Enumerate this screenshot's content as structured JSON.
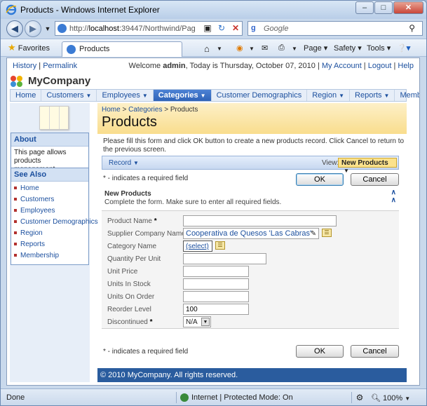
{
  "window": {
    "title": "Products - Windows Internet Explorer",
    "minimize": "–",
    "maximize": "□",
    "close": "✕"
  },
  "addressbar": {
    "url_prefix": "http://",
    "url_host": "localhost",
    "url_rest": ":39447/Northwind/Pag",
    "search_placeholder": "Google"
  },
  "favbar": {
    "favorites_label": "Favorites",
    "tab_label": "Products",
    "page_menu": "Page",
    "safety_menu": "Safety",
    "tools_menu": "Tools"
  },
  "topbar": {
    "history": "History",
    "permalink": "Permalink",
    "welcome_prefix": "Welcome ",
    "user": "admin",
    "welcome_suffix": ", Today is Thursday, October 07, 2010",
    "my_account": "My Account",
    "logout": "Logout",
    "help": "Help"
  },
  "brand": {
    "name": "MyCompany"
  },
  "menu": [
    {
      "label": "Home",
      "dropdown": false,
      "active": false
    },
    {
      "label": "Customers",
      "dropdown": true,
      "active": false
    },
    {
      "label": "Employees",
      "dropdown": true,
      "active": false
    },
    {
      "label": "Categories",
      "dropdown": true,
      "active": true
    },
    {
      "label": "Customer Demographics",
      "dropdown": false,
      "active": false
    },
    {
      "label": "Region",
      "dropdown": true,
      "active": false
    },
    {
      "label": "Reports",
      "dropdown": true,
      "active": false
    },
    {
      "label": "Membership",
      "dropdown": false,
      "active": false
    }
  ],
  "sidebar": {
    "about_title": "About",
    "about_text": "This page allows products management.",
    "see_also_title": "See Also",
    "see_also": [
      "Home",
      "Customers",
      "Employees",
      "Customer Demographics",
      "Region",
      "Reports",
      "Membership"
    ]
  },
  "main": {
    "breadcrumb_home": "Home",
    "breadcrumb_categories": "Categories",
    "breadcrumb_current": "Products",
    "breadcrumb_sep": ">",
    "title": "Products",
    "instructions": "Please fill this form and click OK button to create a new products record. Click Cancel to return to the previous screen.",
    "record_menu": "Record",
    "view_label": "View:",
    "view_value": "New Products",
    "required_note": "* - indicates a required field",
    "ok": "OK",
    "cancel": "Cancel",
    "form_title": "New Products",
    "form_subtitle": "Complete the form. Make sure to enter all required fields."
  },
  "fields": {
    "product_name": {
      "label": "Product Name",
      "value": ""
    },
    "supplier": {
      "label": "Supplier Company Name",
      "value": "Cooperativa de Quesos 'Las Cabras'"
    },
    "category": {
      "label": "Category Name",
      "value": "(select)"
    },
    "quantity_per_unit": {
      "label": "Quantity Per Unit",
      "value": ""
    },
    "unit_price": {
      "label": "Unit Price",
      "value": ""
    },
    "units_in_stock": {
      "label": "Units In Stock",
      "value": ""
    },
    "units_on_order": {
      "label": "Units On Order",
      "value": ""
    },
    "reorder_level": {
      "label": "Reorder Level",
      "value": "100"
    },
    "discontinued": {
      "label": "Discontinued",
      "value": "N/A"
    },
    "required_star": "*"
  },
  "footer": {
    "copyright": "© 2010 MyCompany. All rights reserved."
  },
  "status": {
    "left": "Done",
    "zone": "Internet | Protected Mode: On",
    "zoom": "100%"
  },
  "colors": {
    "accent": "#1b4f9e",
    "header_band": "#f9dd8d",
    "active_menu": "#2f63b8",
    "footer": "#2a5c9e"
  }
}
